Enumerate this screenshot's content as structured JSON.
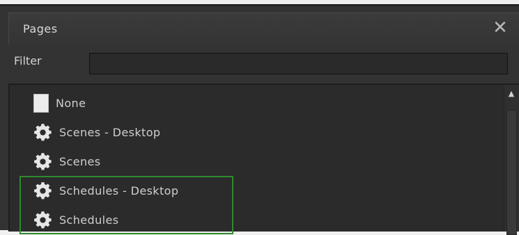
{
  "window": {
    "title": "Pages",
    "close_symbol": "✕"
  },
  "filter": {
    "label": "Filter",
    "value": "",
    "placeholder": ""
  },
  "list": {
    "items": [
      {
        "label": "None",
        "icon": "page-icon"
      },
      {
        "label": "Scenes - Desktop",
        "icon": "gear-icon"
      },
      {
        "label": "Scenes",
        "icon": "gear-icon"
      },
      {
        "label": "Schedules - Desktop",
        "icon": "gear-icon"
      },
      {
        "label": "Schedules",
        "icon": "gear-icon"
      }
    ],
    "scroll_up_symbol": "▲"
  },
  "colors": {
    "panel_bg": "#333333",
    "list_bg": "#2b2b2b",
    "highlight_border": "#2e8a2e",
    "text": "#cfcfcf"
  }
}
